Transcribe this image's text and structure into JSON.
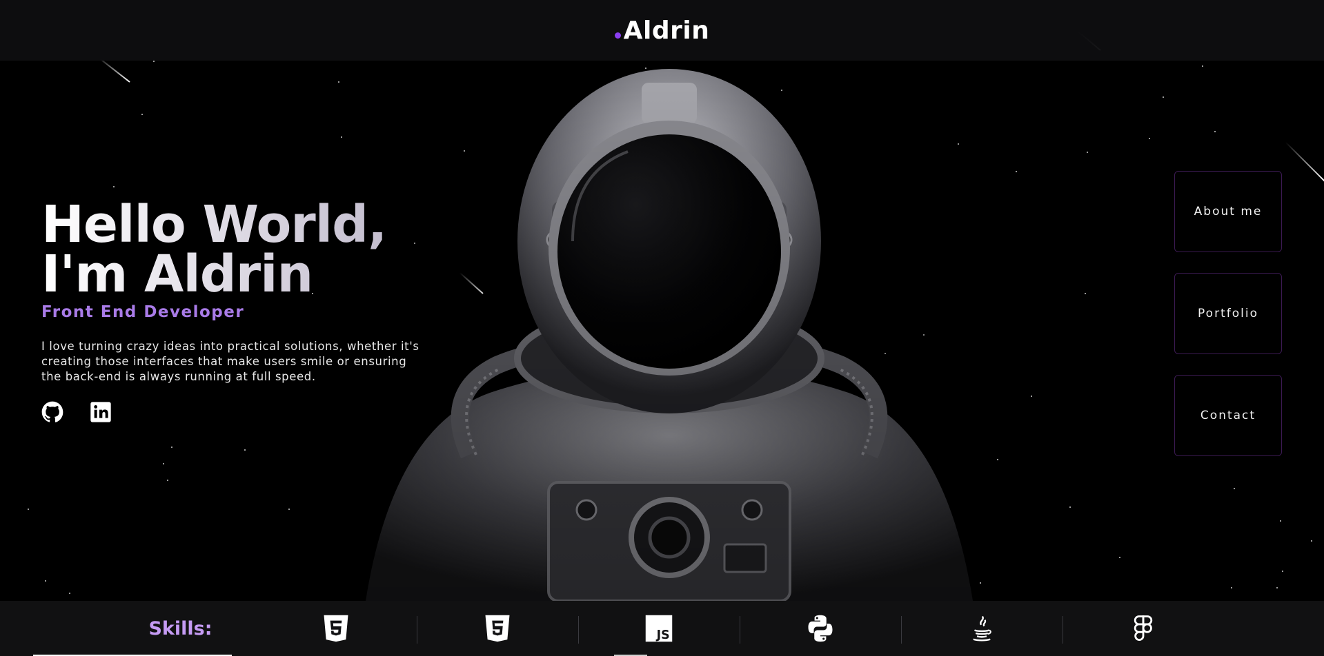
{
  "header": {
    "brand": "Aldrin"
  },
  "hero": {
    "title_line1": "Hello World,",
    "title_line2": "I'm Aldrin",
    "role": "Front End Developer",
    "description": "I love turning crazy ideas into practical solutions, whether it's creating those interfaces that make users smile or ensuring the back-end is always running at full speed.",
    "socials": [
      {
        "icon": "github-icon"
      },
      {
        "icon": "linkedin-icon"
      }
    ]
  },
  "nav": {
    "about": "About me",
    "portfolio": "Portfolio",
    "contact": "Contact"
  },
  "skills": {
    "label": "Skills:",
    "items": [
      {
        "icon": "html5-icon"
      },
      {
        "icon": "css3-icon"
      },
      {
        "icon": "javascript-icon",
        "text": "JS"
      },
      {
        "icon": "python-icon"
      },
      {
        "icon": "java-icon"
      },
      {
        "icon": "figma-icon"
      }
    ]
  },
  "colors": {
    "accent": "#8a3ef1",
    "role": "#a97be8",
    "skills_label": "#c59bf3",
    "nav_border": "#3b1a52"
  }
}
